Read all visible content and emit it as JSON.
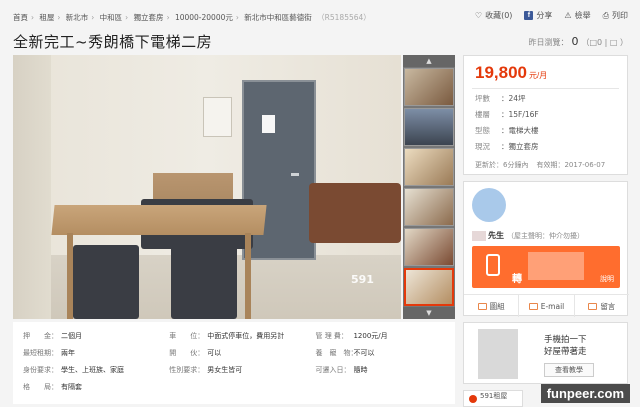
{
  "breadcrumb": [
    "首頁",
    "租屋",
    "新北市",
    "中和區",
    "獨立套房",
    "10000-20000元",
    "新北市中和區藝德街"
  ],
  "listing_code": "（R5185564）",
  "toplinks": {
    "favorite": "收藏(0)",
    "share": "分享",
    "print_icon_label": "檢舉",
    "print": "列印"
  },
  "title": "全新完工~秀朗橋下電梯二房",
  "views": {
    "label": "昨日瀏覽：",
    "count": "0",
    "extra": "（□0 | □ ）"
  },
  "photo": {
    "watermark": "591"
  },
  "price": {
    "value": "19,800",
    "unit": "元/月"
  },
  "attributes": [
    {
      "key": "坪數",
      "value": "24坪"
    },
    {
      "key": "樓層",
      "value": "15F/16F"
    },
    {
      "key": "型態",
      "value": "電梯大樓"
    },
    {
      "key": "現況",
      "value": "獨立套房"
    }
  ],
  "update": {
    "updated": "更新於：6分鐘內",
    "valid": "有效期：2017-06-07"
  },
  "agent": {
    "name": "先生",
    "role": "（屋主聲明：仲介勿擾）",
    "call_prefix": "轉",
    "call_label": "說明"
  },
  "actions": [
    {
      "label": "圖組",
      "icon": "gallery-icon"
    },
    {
      "label": "E-mail",
      "icon": "mail-icon"
    },
    {
      "label": "留言",
      "icon": "message-icon"
    }
  ],
  "info": [
    [
      {
        "k": "押　　金：",
        "v": "二個月"
      },
      {
        "k": "車　　位：",
        "v": "中面式停車位，費用另計"
      },
      {
        "k": "管 理 費：",
        "v": "1200元/月"
      }
    ],
    [
      {
        "k": "最短租期：",
        "v": "兩年"
      },
      {
        "k": "開　　伙：",
        "v": "可以"
      },
      {
        "k": "養　寵　物：",
        "v": "不可以"
      }
    ],
    [
      {
        "k": "身份要求：",
        "v": "學生、上班族、家庭"
      },
      {
        "k": "性別要求：",
        "v": "男女生皆可"
      },
      {
        "k": "可遷入日：",
        "v": "隨時"
      }
    ],
    [
      {
        "k": "格　　局：",
        "v": "有隔套"
      },
      {
        "k": "",
        "v": ""
      },
      {
        "k": "",
        "v": ""
      }
    ]
  ],
  "promo": {
    "line1": "手機拍一下",
    "line2": "好屋帶著走",
    "button": "查看教學"
  },
  "bottom": {
    "label": "591租屋"
  },
  "brand": "funpeer.com"
}
